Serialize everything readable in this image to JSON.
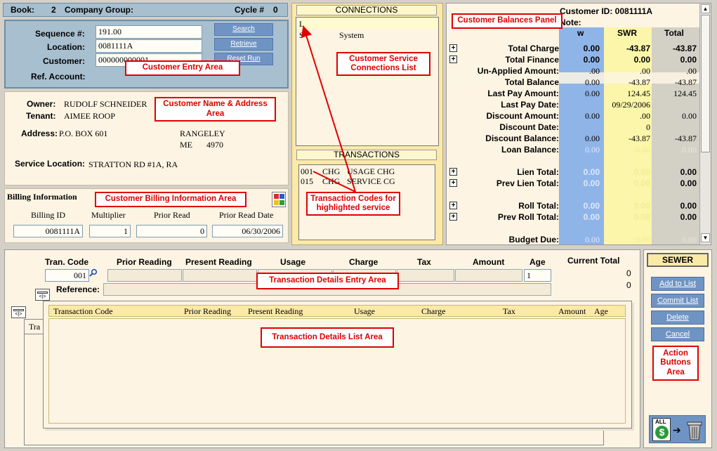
{
  "top": {
    "book_label": "Book:",
    "book_value": "2",
    "company_group_label": "Company Group:",
    "cycle_label": "Cycle #",
    "cycle_value": "0"
  },
  "entry": {
    "sequence_label": "Sequence #:",
    "sequence_value": "191.00",
    "location_label": "Location:",
    "location_value": "0081111A",
    "customer_label": "Customer:",
    "customer_value": "000000000001",
    "ref_label": "Ref. Account:",
    "search_btn": "Search",
    "retrieve_btn": "Retrieve",
    "reset_btn": "Reset Run"
  },
  "name_area": {
    "owner_label": "Owner:",
    "owner_value": "RUDOLF SCHNEIDER",
    "tenant_label": "Tenant:",
    "tenant_value": "AIMEE ROOP",
    "address_label": "Address:",
    "address_value": "P.O. BOX 601",
    "city": "RANGELEY",
    "state": "ME",
    "zip": "4970",
    "service_location_label": "Service Location:",
    "service_location_value": "STRATTON RD #1A, RA"
  },
  "billing": {
    "title": "Billing Information",
    "headers": [
      "Billing ID",
      "Multiplier",
      "Prior Read",
      "Prior Read Date"
    ],
    "values": [
      "0081111A",
      "1",
      "0",
      "06/30/2006"
    ]
  },
  "connections": {
    "title": "CONNECTIONS",
    "rows": [
      {
        "code": "L",
        "name": ""
      },
      {
        "code": "S",
        "name": "System"
      }
    ]
  },
  "transactions": {
    "title": "TRANSACTIONS",
    "rows": [
      {
        "code": "001",
        "type": "CHG",
        "desc": "USAGE CHG"
      },
      {
        "code": "015",
        "type": "CHG",
        "desc": "SERVICE CG"
      }
    ]
  },
  "balances": {
    "customer_id": "Customer ID: 0081111A",
    "note_label": "Note:",
    "col_headers": [
      "w",
      "SWR",
      "Total"
    ],
    "rows": [
      {
        "label": "Total Charge",
        "w": "0.00",
        "swr": "-43.87",
        "total": "-43.87"
      },
      {
        "label": "Total Finance",
        "w": "0.00",
        "swr": "0.00",
        "total": "0.00"
      },
      {
        "label": "Un-Applied Amount:",
        "w": ".00",
        "swr": ".00",
        "total": ".00"
      },
      {
        "label": "Total Balance",
        "w": "0.00",
        "swr": "-43.87",
        "total": "-43.87"
      },
      {
        "label": "Last Pay Amount:",
        "w": "0.00",
        "swr": "124.45",
        "total": "124.45"
      },
      {
        "label": "Last Pay Date:",
        "w": "",
        "swr": "09/29/2006",
        "total": ""
      },
      {
        "label": "Discount Amount:",
        "w": "0.00",
        "swr": ".00",
        "total": "0.00"
      },
      {
        "label": "Discount Date:",
        "w": "",
        "swr": "0",
        "total": ""
      },
      {
        "label": "Discount Balance:",
        "w": "0.00",
        "swr": "-43.87",
        "total": "-43.87"
      },
      {
        "label": "Loan Balance:",
        "w": "0.00",
        "swr": "0.00",
        "total": "0.00"
      },
      {
        "label": "Lien Total:",
        "w": "0.00",
        "swr": "0.00",
        "total": "0.00"
      },
      {
        "label": "Prev Lien Total:",
        "w": "0.00",
        "swr": "0.00",
        "total": "0.00"
      },
      {
        "label": "Roll Total:",
        "w": "0.00",
        "swr": "0.00",
        "total": "0.00"
      },
      {
        "label": "Prev Roll Total:",
        "w": "0.00",
        "swr": "0.00",
        "total": "0.00"
      },
      {
        "label": "Budget Due:",
        "w": "0.00",
        "swr": "0.00",
        "total": "0.00"
      }
    ]
  },
  "trans_entry": {
    "headers": [
      "Tran. Code",
      "Prior Reading",
      "Present Reading",
      "Usage",
      "Charge",
      "Tax",
      "Amount",
      "Age",
      "Current Total"
    ],
    "tran_code": "001",
    "age": "1",
    "current_total_1": "0",
    "current_total_2": "0",
    "reference_label": "Reference:"
  },
  "trans_list": {
    "headers": [
      "Transaction Code",
      "Prior Reading",
      "Present Reading",
      "Usage",
      "Charge",
      "Tax",
      "Amount",
      "Age"
    ],
    "behind_tab": "Tra"
  },
  "actions": {
    "service_label": "SEWER",
    "add": "Add to List",
    "commit": "Commit List",
    "delete": "Delete",
    "cancel": "Cancel",
    "all_label": "ALL"
  },
  "annotations": {
    "entry": "Customer Entry Area",
    "name": "Customer Name & Address Area",
    "billing": "Customer Billing Information Area",
    "connections": "Customer Service Connections List",
    "codes": "Transaction Codes for highlighted service",
    "balances": "Customer Balances Panel",
    "trans_entry": "Transaction Details Entry Area",
    "trans_list": "Transaction Details List Area",
    "actions": "Action Buttons Area"
  }
}
